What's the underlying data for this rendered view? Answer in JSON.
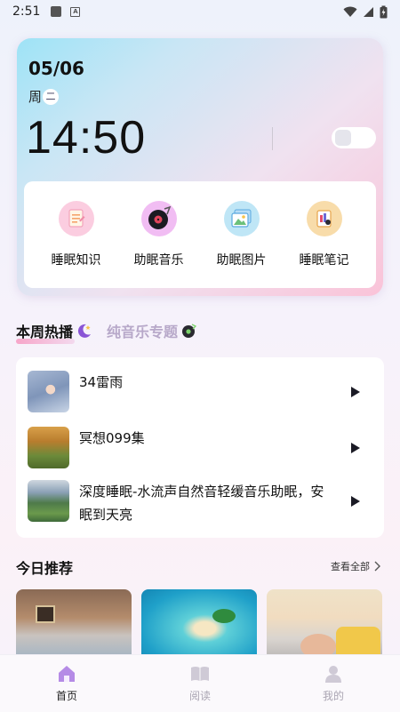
{
  "status_bar": {
    "time": "2:51"
  },
  "clock": {
    "date": "05/06",
    "weekday_prefix": "周",
    "weekday_num": "二",
    "time": "14:50"
  },
  "features": [
    {
      "label": "睡眠知识",
      "icon": "sleep-knowledge-icon"
    },
    {
      "label": "助眠音乐",
      "icon": "music-record-icon"
    },
    {
      "label": "助眠图片",
      "icon": "picture-icon"
    },
    {
      "label": "睡眠笔记",
      "icon": "notebook-icon"
    }
  ],
  "tabs": {
    "active": "本周热播",
    "inactive": "纯音乐专题"
  },
  "hot_list": [
    {
      "title": "34雷雨"
    },
    {
      "title": "冥想099集"
    },
    {
      "title": "深度睡眠-水流声自然音轻缓音乐助眠，安眠到天亮"
    }
  ],
  "today": {
    "title": "今日推荐",
    "view_all": "查看全部"
  },
  "bottom_nav": [
    {
      "label": "首页",
      "active": true
    },
    {
      "label": "阅读",
      "active": false
    },
    {
      "label": "我的",
      "active": false
    }
  ],
  "colors": {
    "accent": "#a77be0",
    "inactive": "#c5c0cc"
  }
}
